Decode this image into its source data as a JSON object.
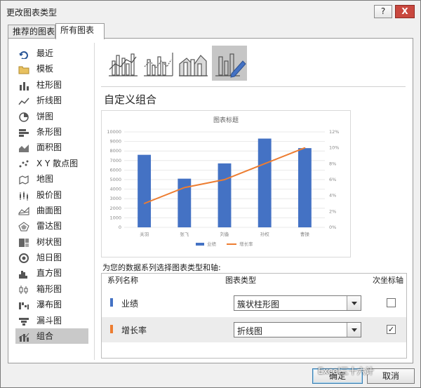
{
  "window": {
    "title": "更改图表类型",
    "help_label": "?",
    "close_label": "X"
  },
  "tabs": [
    {
      "label": "推荐的图表"
    },
    {
      "label": "所有图表"
    }
  ],
  "sidebar": {
    "selected": "组合",
    "items": [
      {
        "label": "最近",
        "icon": "recent-icon"
      },
      {
        "label": "模板",
        "icon": "folder-icon"
      },
      {
        "label": "柱形图",
        "icon": "column-chart-icon"
      },
      {
        "label": "折线图",
        "icon": "line-chart-icon"
      },
      {
        "label": "饼图",
        "icon": "pie-chart-icon"
      },
      {
        "label": "条形图",
        "icon": "bar-chart-icon"
      },
      {
        "label": "面积图",
        "icon": "area-chart-icon"
      },
      {
        "label": "X Y 散点图",
        "icon": "scatter-chart-icon"
      },
      {
        "label": "地图",
        "icon": "map-chart-icon"
      },
      {
        "label": "股价图",
        "icon": "stock-chart-icon"
      },
      {
        "label": "曲面图",
        "icon": "surface-chart-icon"
      },
      {
        "label": "雷达图",
        "icon": "radar-chart-icon"
      },
      {
        "label": "树状图",
        "icon": "treemap-chart-icon"
      },
      {
        "label": "旭日图",
        "icon": "sunburst-chart-icon"
      },
      {
        "label": "直方图",
        "icon": "histogram-chart-icon"
      },
      {
        "label": "箱形图",
        "icon": "box-whisker-chart-icon"
      },
      {
        "label": "瀑布图",
        "icon": "waterfall-chart-icon"
      },
      {
        "label": "漏斗图",
        "icon": "funnel-chart-icon"
      },
      {
        "label": "组合",
        "icon": "combo-chart-icon"
      }
    ]
  },
  "main": {
    "section_title": "自定义组合",
    "subtype_icons": [
      "clustered-column-line-icon",
      "clustered-column-line-secondary-icon",
      "stacked-area-column-icon",
      "custom-combo-icon"
    ],
    "selected_subtype": 3,
    "prompt": "为您的数据系列选择图表类型和轴:",
    "table": {
      "headers": {
        "name": "系列名称",
        "type": "图表类型",
        "secondary": "次坐标轴"
      },
      "rows": [
        {
          "name": "业绩",
          "chart_type": "簇状柱形图",
          "secondary_axis": false,
          "color": "#4472c4"
        },
        {
          "name": "增长率",
          "chart_type": "折线图",
          "secondary_axis": true,
          "color": "#ed7d31"
        }
      ]
    }
  },
  "chart_data": {
    "type": "bar",
    "title": "图表标题",
    "categories": [
      "关羽",
      "张飞",
      "刘备",
      "孙权",
      "曹操"
    ],
    "series": [
      {
        "name": "业绩",
        "type": "bar",
        "axis": "primary",
        "color": "#4472c4",
        "values": [
          7600,
          5100,
          6700,
          9300,
          8300
        ]
      },
      {
        "name": "增长率",
        "type": "line",
        "axis": "secondary",
        "color": "#ed7d31",
        "values": [
          3,
          5,
          6,
          8,
          10
        ]
      }
    ],
    "y_ticks": [
      "10000",
      "9000",
      "8000",
      "7000",
      "6000",
      "5000",
      "4000",
      "3000",
      "2000",
      "1000",
      "0"
    ],
    "y2_ticks": [
      "12%",
      "10%",
      "8%",
      "6%",
      "4%",
      "2%",
      "0%"
    ],
    "ylim": [
      0,
      10000
    ],
    "y2lim": [
      0,
      12
    ],
    "legend": "bottom",
    "grid": true
  },
  "buttons": {
    "ok": "确定",
    "cancel": "取消"
  },
  "watermark": "Excel三十六计"
}
